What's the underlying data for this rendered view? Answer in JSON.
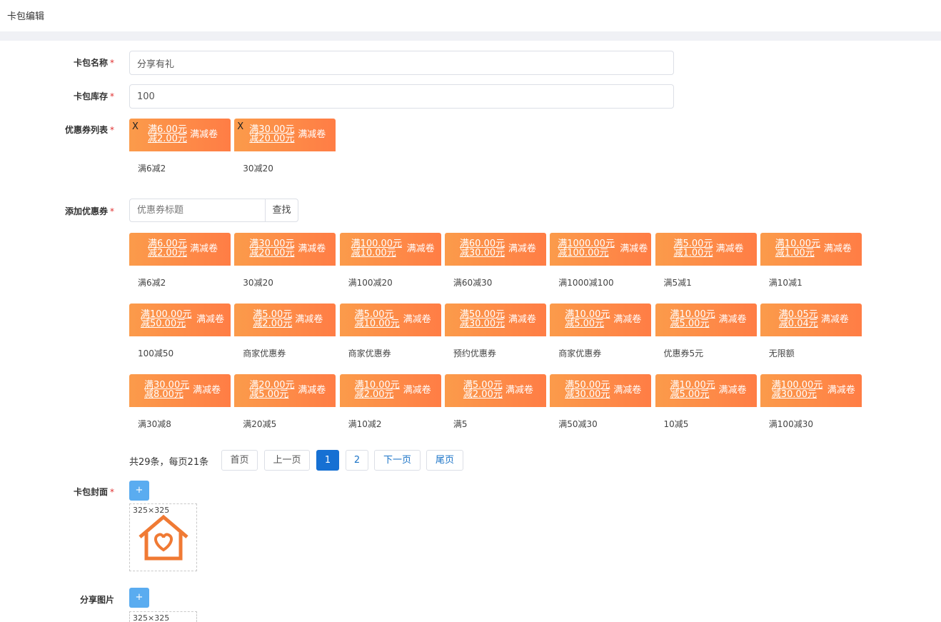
{
  "page": {
    "title": "卡包编辑"
  },
  "form": {
    "name_label": "卡包名称",
    "name_value": "分享有礼",
    "stock_label": "卡包库存",
    "stock_value": "100",
    "list_label": "优惠券列表",
    "add_label": "添加优惠券",
    "cover_label": "卡包封面",
    "share_label": "分享图片",
    "required_mark": "*"
  },
  "selected_coupons": [
    {
      "line1": "满6.00元",
      "line2": "减2.00元",
      "tag": "满减卷",
      "name": "满6减2",
      "remove": "X"
    },
    {
      "line1": "满30.00元",
      "line2": "减20.00元",
      "tag": "满减卷",
      "name": "30减20",
      "remove": "X"
    }
  ],
  "search": {
    "placeholder": "优惠券标题",
    "button": "查找"
  },
  "coupon_grid": [
    {
      "line1": "满6.00元",
      "line2": "减2.00元",
      "tag": "满减卷",
      "name": "满6减2"
    },
    {
      "line1": "满30.00元",
      "line2": "减20.00元",
      "tag": "满减卷",
      "name": "30减20"
    },
    {
      "line1": "满100.00元",
      "line2": "减10.00元",
      "tag": "满减卷",
      "name": "满100减20"
    },
    {
      "line1": "满60.00元",
      "line2": "减30.00元",
      "tag": "满减卷",
      "name": "满60减30"
    },
    {
      "line1": "满1000.00元",
      "line2": "减100.00元",
      "tag": "满减卷",
      "name": "满1000减100"
    },
    {
      "line1": "满5.00元",
      "line2": "减1.00元",
      "tag": "满减卷",
      "name": "满5减1"
    },
    {
      "line1": "满10.00元",
      "line2": "减1.00元",
      "tag": "满减卷",
      "name": "满10减1"
    },
    {
      "line1": "满100.00元",
      "line2": "减50.00元",
      "tag": "满减卷",
      "name": "100减50"
    },
    {
      "line1": "满5.00元",
      "line2": "减2.00元",
      "tag": "满减卷",
      "name": "商家优惠券"
    },
    {
      "line1": "满5.00元",
      "line2": "减10.00元",
      "tag": "满减卷",
      "name": "商家优惠券"
    },
    {
      "line1": "满50.00元",
      "line2": "减30.00元",
      "tag": "满减卷",
      "name": "预约优惠券"
    },
    {
      "line1": "满10.00元",
      "line2": "减5.00元",
      "tag": "满减卷",
      "name": "商家优惠券"
    },
    {
      "line1": "满10.00元",
      "line2": "减5.00元",
      "tag": "满减卷",
      "name": "优惠券5元"
    },
    {
      "line1": "满0.05元",
      "line2": "减0.04元",
      "tag": "满减卷",
      "name": "无限额"
    },
    {
      "line1": "满30.00元",
      "line2": "减8.00元",
      "tag": "满减卷",
      "name": "满30减8"
    },
    {
      "line1": "满20.00元",
      "line2": "减5.00元",
      "tag": "满减卷",
      "name": "满20减5"
    },
    {
      "line1": "满10.00元",
      "line2": "减2.00元",
      "tag": "满减卷",
      "name": "满10减2"
    },
    {
      "line1": "满5.00元",
      "line2": "减2.00元",
      "tag": "满减卷",
      "name": "满5"
    },
    {
      "line1": "满50.00元",
      "line2": "减30.00元",
      "tag": "满减卷",
      "name": "满50减30"
    },
    {
      "line1": "满10.00元",
      "line2": "减5.00元",
      "tag": "满减卷",
      "name": "10减5"
    },
    {
      "line1": "满100.00元",
      "line2": "减30.00元",
      "tag": "满减卷",
      "name": "满100减30"
    }
  ],
  "pagination": {
    "summary": "共29条，每页21条",
    "first": "首页",
    "prev": "上一页",
    "page1": "1",
    "page2": "2",
    "next": "下一页",
    "last": "尾页"
  },
  "cover": {
    "add_button": "+",
    "dimensions": "325×325",
    "icon": "house-heart-icon"
  },
  "share": {
    "add_button": "+",
    "dimensions": "325×325"
  },
  "colors": {
    "coupon_start": "#fb9b4b",
    "coupon_end": "#ff7d45",
    "primary": "#1670d3",
    "upload": "#5aacf0",
    "required": "#e03030"
  }
}
